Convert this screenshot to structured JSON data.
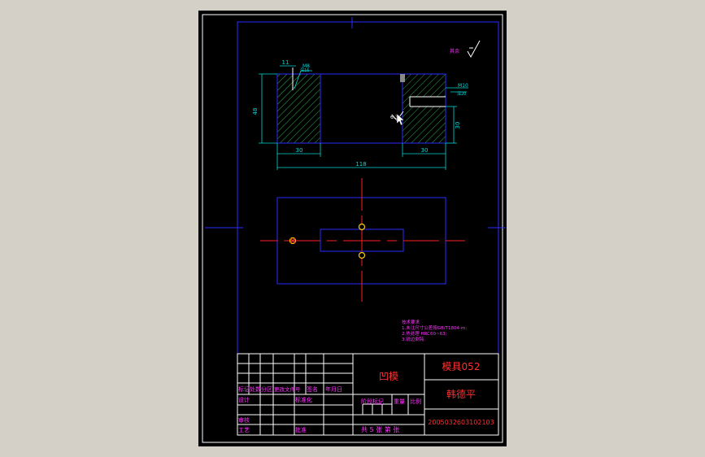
{
  "drawing": {
    "top_view": {
      "dims": {
        "left_height": "48",
        "right_height": "30",
        "left_width": "30",
        "right_width": "30",
        "overall_width": "118",
        "top_left": "11",
        "thread_left_1": "M8",
        "thread_left_2": "深16",
        "thread_right_1": "M10",
        "thread_right_2": "深20",
        "roughness": "6.3"
      }
    },
    "notes": {
      "title": "技术要求",
      "line1": "1.未注尺寸公差按GB/T1804-m;",
      "line2": "2.热处理 HRC60~63;",
      "line3": "3.锐边倒钝."
    },
    "surface_symbol_note": "其余"
  },
  "title_block": {
    "part_name": "凹模",
    "drawing_no": "模具052",
    "designer_name": "韩德平",
    "student_id": "2005032603102103",
    "sheet_info": "共 5 张 第  张",
    "headers": {
      "row_mark": "标记",
      "row_count": "处数",
      "row_zone": "分区",
      "row_change": "更改文件号",
      "row_sign": "签名",
      "row_date": "年月日",
      "design": "设计",
      "standard": "标准化",
      "stage_mark": "阶段标记",
      "weight": "重量",
      "scale": "比例",
      "review": "审核",
      "process": "工艺",
      "approve": "批准"
    }
  }
}
